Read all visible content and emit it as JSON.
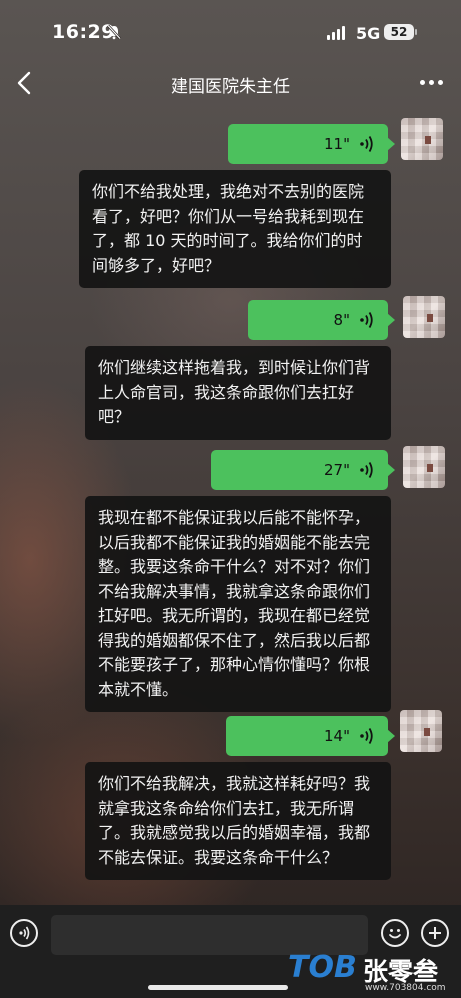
{
  "status": {
    "time": "16:29",
    "network": "5G",
    "battery": "52"
  },
  "header": {
    "title": "建国医院朱主任"
  },
  "messages": [
    {
      "duration": "11\"",
      "caption": "你们不给我处理，我绝对不去别的医院看了，好吧？你们从一号给我耗到现在了，都 10 天的时间了。我给你们的时间够多了，好吧？"
    },
    {
      "duration": "8\"",
      "caption": "你们继续这样拖着我，到时候让你们背上人命官司，我这条命跟你们去扛好吧？"
    },
    {
      "duration": "27\"",
      "caption": "我现在都不能保证我以后能不能怀孕，以后我都不能保证我的婚姻能不能去完整。我要这条命干什么？对不对？你们不给我解决事情，我就拿这条命跟你们扛好吧。我无所谓的，我现在都已经觉得我的婚姻都保不住了，然后我以后都不能要孩子了，那种心情你懂吗？你根本就不懂。"
    },
    {
      "duration": "14\"",
      "caption": "你们不给我解决，我就这样耗好吗？我就拿我这条命给你们去扛，我无所谓了。我就感觉我以后的婚姻幸福，我都不能去保证。我要这条命干什么？"
    }
  ],
  "watermark": {
    "logo": "TOB",
    "name": "张零叁",
    "url": "www.703804.com"
  },
  "icons": {
    "back": "chevron-left-icon",
    "more": "more-dots-icon",
    "voice": "voice-wave-icon",
    "emoji": "emoji-icon",
    "plus": "plus-icon",
    "mute": "bell-slash-icon"
  },
  "colors": {
    "voice_bubble": "#4cc15d",
    "caption_bg": "#141414",
    "composer_bg": "#1f1f1f"
  }
}
